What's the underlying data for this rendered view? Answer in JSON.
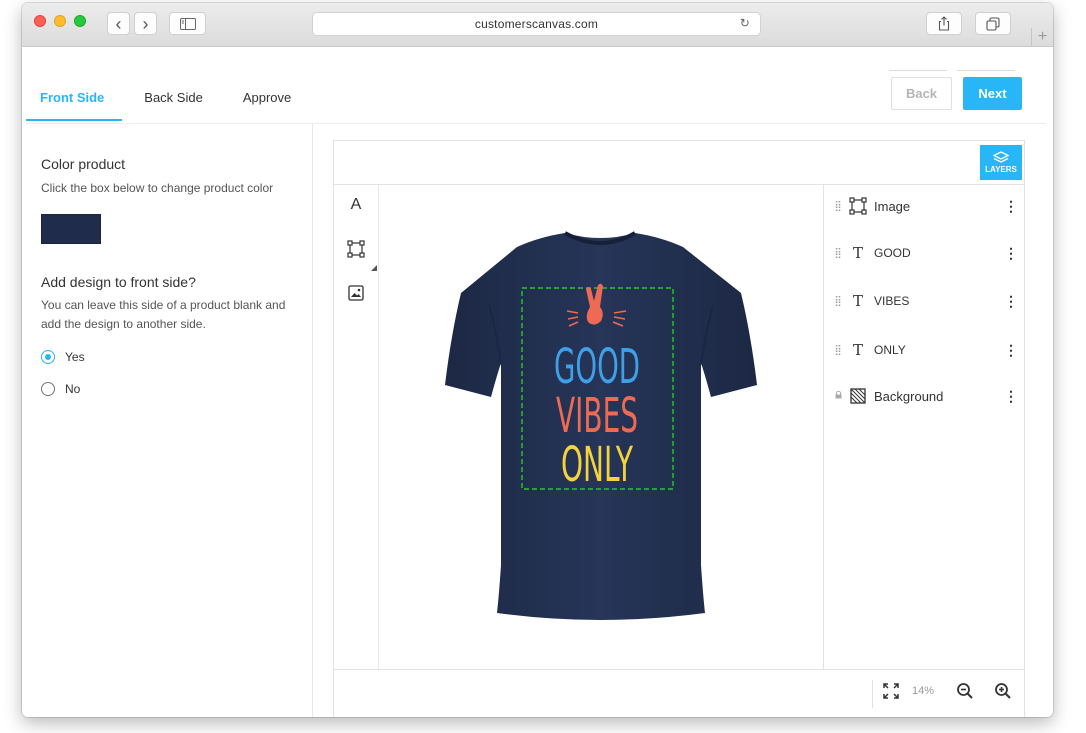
{
  "browser": {
    "url": "customerscanvas.com",
    "reload_glyph": "↻",
    "back_glyph": "‹",
    "forward_glyph": "›",
    "new_tab_glyph": "+"
  },
  "tabs": [
    {
      "label": "Front Side",
      "active": true
    },
    {
      "label": "Back Side",
      "active": false
    },
    {
      "label": "Approve",
      "active": false
    }
  ],
  "nav": {
    "back_label": "Back",
    "next_label": "Next"
  },
  "left_panel": {
    "color_title": "Color product",
    "color_desc": "Click the box below to change product color",
    "swatch_color": "#1f2c4b",
    "design_title": "Add design to front side?",
    "design_desc": "You can leave this side of a product blank and add the design to another side.",
    "options": [
      {
        "label": "Yes",
        "checked": true
      },
      {
        "label": "No",
        "checked": false
      }
    ]
  },
  "editor": {
    "layers_label": "LAYERS",
    "tools": [
      "text-tool",
      "shape-tool",
      "image-tool"
    ],
    "text_tool_glyph": "A",
    "layers": [
      {
        "name": "Image",
        "type": "image",
        "locked": false
      },
      {
        "name": "GOOD",
        "type": "text",
        "locked": false
      },
      {
        "name": "VIBES",
        "type": "text",
        "locked": false
      },
      {
        "name": "ONLY",
        "type": "text",
        "locked": false
      },
      {
        "name": "Background",
        "type": "background",
        "locked": true
      }
    ],
    "text_layer_glyph": "T",
    "layer_menu_glyph": "⋮",
    "grip_glyph": "⣿",
    "lock_glyph": "🔒",
    "zoom": "14%"
  },
  "design": {
    "line1": "GOOD",
    "line2": "VIBES",
    "line3": "ONLY",
    "shirt_color": "#22304f",
    "good_color": "#3ea0e6",
    "vibes_color": "#ee6a52",
    "only_color": "#f5d33a",
    "selection_color": "#22cc22"
  },
  "colors": {
    "accent": "#29b6f6"
  }
}
